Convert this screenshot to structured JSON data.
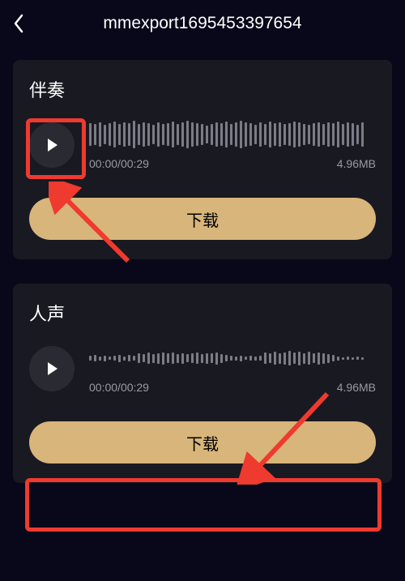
{
  "header": {
    "title": "mmexport1695453397654"
  },
  "tracks": [
    {
      "title": "伴奏",
      "time_current": "00:00",
      "time_total": "00:29",
      "size": "4.96MB",
      "download_label": "下载"
    },
    {
      "title": "人声",
      "time_current": "00:00",
      "time_total": "00:29",
      "size": "4.96MB",
      "download_label": "下载"
    }
  ],
  "waveform_heights": [
    28,
    26,
    30,
    24,
    28,
    32,
    26,
    30,
    28,
    34,
    26,
    30,
    28,
    24,
    30,
    26,
    28,
    32,
    26,
    30,
    34,
    30,
    28,
    26,
    22,
    26,
    30,
    28,
    32,
    26,
    30,
    34,
    30,
    28,
    24,
    30,
    26,
    32,
    28,
    30,
    26,
    28,
    32,
    30,
    26,
    24,
    28,
    30,
    26,
    30,
    28,
    32,
    26,
    30,
    28,
    24,
    30
  ],
  "waveform_heights_2": [
    6,
    8,
    5,
    7,
    4,
    6,
    9,
    5,
    8,
    6,
    12,
    10,
    14,
    11,
    13,
    15,
    12,
    14,
    11,
    13,
    10,
    12,
    14,
    11,
    13,
    12,
    15,
    11,
    8,
    6,
    5,
    7,
    4,
    6,
    5,
    6,
    14,
    12,
    16,
    13,
    15,
    18,
    14,
    17,
    13,
    16,
    12,
    15,
    13,
    11,
    8,
    5,
    3,
    4,
    3,
    4,
    3
  ]
}
